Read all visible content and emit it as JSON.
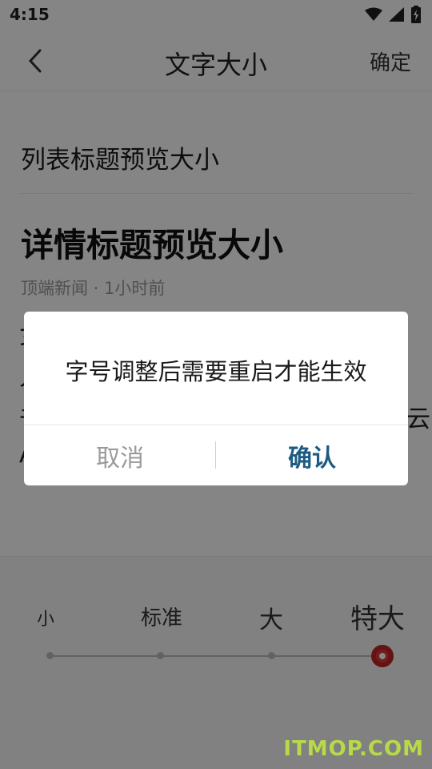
{
  "status_bar": {
    "time": "4:15",
    "icons": [
      "wifi-icon",
      "signal-icon",
      "battery-charging-icon"
    ]
  },
  "topbar": {
    "title": "文字大小",
    "confirm_label": "确定",
    "back_icon": "chevron-left-icon"
  },
  "preview": {
    "list_title": "列表标题预览大小",
    "detail_title": "详情标题预览大小",
    "meta": "顶端新闻 · 1小时前",
    "body_fragments": [
      "女",
      "人",
      "千",
      "A",
      "云"
    ]
  },
  "size_selector": {
    "options": [
      "小",
      "标准",
      "大",
      "特大"
    ],
    "selected_index": 3,
    "accent_color": "#c02424"
  },
  "dialog": {
    "message": "字号调整后需要重启才能生效",
    "cancel_label": "取消",
    "ok_label": "确认",
    "ok_color": "#1d5b84"
  },
  "watermark": "ITMOP.COM"
}
